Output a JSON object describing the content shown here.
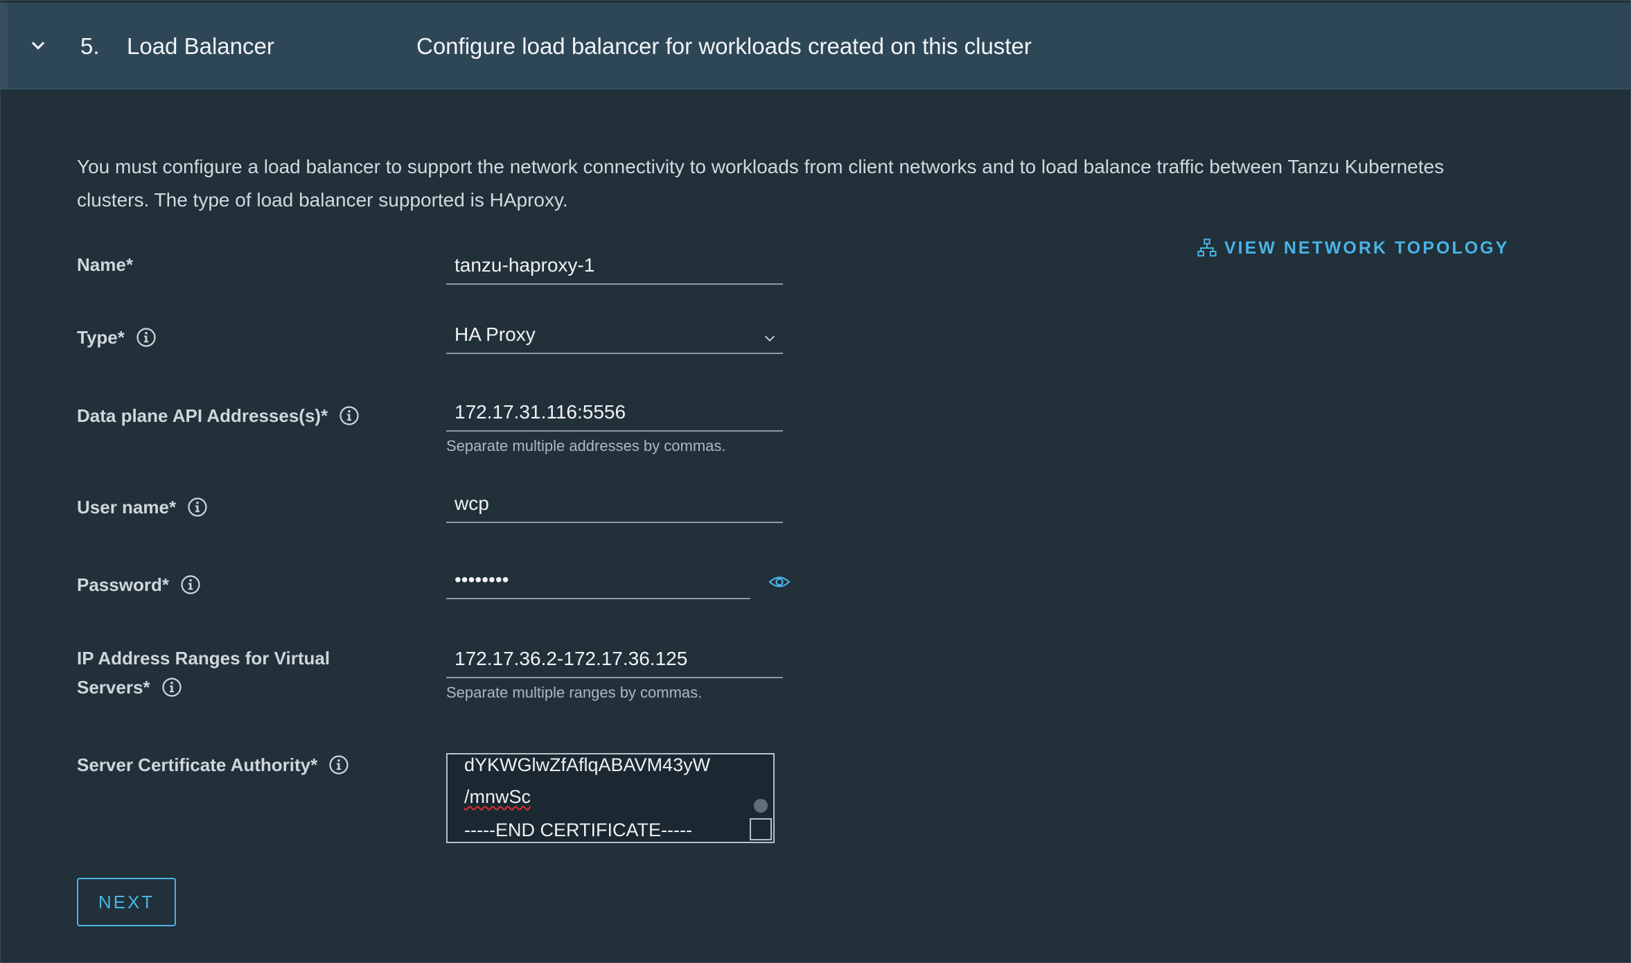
{
  "header": {
    "step_number": "5.",
    "step_title": "Load Balancer",
    "step_description": "Configure load balancer for workloads created on this cluster"
  },
  "intro_text": "You must configure a load balancer to support the network connectivity to workloads from client networks and to load balance traffic between Tanzu Kubernetes clusters. The type of load balancer supported is HAproxy.",
  "topology_link": "VIEW NETWORK TOPOLOGY",
  "form": {
    "name": {
      "label": "Name*",
      "value": "tanzu-haproxy-1"
    },
    "type": {
      "label": "Type*",
      "value": "HA Proxy"
    },
    "dataplane": {
      "label": "Data plane API Addresses(s)*",
      "value": "172.17.31.116:5556",
      "helper": "Separate multiple addresses by commas."
    },
    "username": {
      "label": "User name*",
      "value": "wcp"
    },
    "password": {
      "label": "Password*",
      "value": "••••••••"
    },
    "ip_ranges": {
      "label_line1": "IP Address Ranges for Virtual",
      "label_line2": "Servers*",
      "value": "172.17.36.2-172.17.36.125",
      "helper": "Separate multiple ranges by commas."
    },
    "cert": {
      "label": "Server Certificate Authority*",
      "lines": [
        "dYKWGlwZfAflqABAVM43yW",
        "/mnwSc",
        "-----END CERTIFICATE-----"
      ]
    }
  },
  "next_button": "NEXT",
  "colors": {
    "accent": "#4ab4e6",
    "header_bg": "#2e4757",
    "page_bg": "#213039"
  }
}
